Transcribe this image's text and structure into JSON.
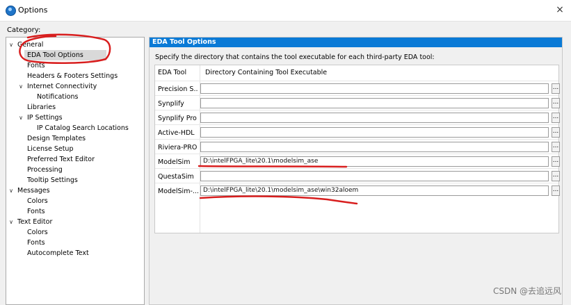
{
  "window": {
    "title": "Options",
    "close_label": "×"
  },
  "category_label": "Category:",
  "tree": {
    "items": [
      {
        "label": "General",
        "depth": 0,
        "arrow": "∨",
        "selected": false
      },
      {
        "label": "EDA Tool Options",
        "depth": 1,
        "arrow": "",
        "selected": true
      },
      {
        "label": "Fonts",
        "depth": 1,
        "arrow": "",
        "selected": false
      },
      {
        "label": "Headers & Footers Settings",
        "depth": 1,
        "arrow": "",
        "selected": false
      },
      {
        "label": "Internet Connectivity",
        "depth": 1,
        "arrow": "∨",
        "selected": false
      },
      {
        "label": "Notifications",
        "depth": 2,
        "arrow": "",
        "selected": false
      },
      {
        "label": "Libraries",
        "depth": 1,
        "arrow": "",
        "selected": false
      },
      {
        "label": "IP Settings",
        "depth": 1,
        "arrow": "∨",
        "selected": false
      },
      {
        "label": "IP Catalog Search Locations",
        "depth": 2,
        "arrow": "",
        "selected": false
      },
      {
        "label": "Design Templates",
        "depth": 1,
        "arrow": "",
        "selected": false
      },
      {
        "label": "License Setup",
        "depth": 1,
        "arrow": "",
        "selected": false
      },
      {
        "label": "Preferred Text Editor",
        "depth": 1,
        "arrow": "",
        "selected": false
      },
      {
        "label": "Processing",
        "depth": 1,
        "arrow": "",
        "selected": false
      },
      {
        "label": "Tooltip Settings",
        "depth": 1,
        "arrow": "",
        "selected": false
      },
      {
        "label": "Messages",
        "depth": 0,
        "arrow": "∨",
        "selected": false
      },
      {
        "label": "Colors",
        "depth": 1,
        "arrow": "",
        "selected": false
      },
      {
        "label": "Fonts",
        "depth": 1,
        "arrow": "",
        "selected": false
      },
      {
        "label": "Text Editor",
        "depth": 0,
        "arrow": "∨",
        "selected": false
      },
      {
        "label": "Colors",
        "depth": 1,
        "arrow": "",
        "selected": false
      },
      {
        "label": "Fonts",
        "depth": 1,
        "arrow": "",
        "selected": false
      },
      {
        "label": "Autocomplete Text",
        "depth": 1,
        "arrow": "",
        "selected": false
      }
    ]
  },
  "panel": {
    "header": "EDA Tool Options",
    "description": "Specify the directory that contains the tool executable for each third-party EDA tool:",
    "col_tool": "EDA Tool",
    "col_dir": "Directory Containing Tool Executable",
    "browse_label": "...",
    "tools": [
      {
        "name": "Precision S...",
        "path": ""
      },
      {
        "name": "Synplify",
        "path": ""
      },
      {
        "name": "Synplify Pro",
        "path": ""
      },
      {
        "name": "Active-HDL",
        "path": ""
      },
      {
        "name": "Riviera-PRO",
        "path": ""
      },
      {
        "name": "ModelSim",
        "path": "D:\\intelFPGA_lite\\20.1\\modelsim_ase"
      },
      {
        "name": "QuestaSim",
        "path": ""
      },
      {
        "name": "ModelSim-...",
        "path": "D:\\intelFPGA_lite\\20.1\\modelsim_ase\\win32aloem"
      }
    ]
  },
  "annotation_color": "#d81e1e",
  "header_color": "#0a7ad6",
  "watermark": "CSDN @去追远风"
}
